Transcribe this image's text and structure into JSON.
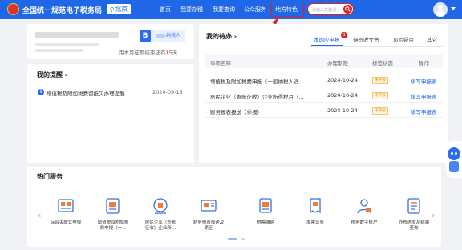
{
  "header": {
    "site_title": "全国统一规范电子税务局",
    "city": "北京",
    "nav": [
      "首页",
      "我要办税",
      "我要查询",
      "公众服务",
      "地方特色"
    ],
    "search_placeholder": "请输入关键词",
    "highlight_color": "#e02020",
    "brand_color": "#1f67e6"
  },
  "user_card": {
    "taxpayer_badge": "B",
    "taxpayer_type": "纳税人",
    "deadline_prefix": "距本月征期结束还有",
    "deadline_days": "15",
    "deadline_suffix": "天"
  },
  "reminders": {
    "title": "我的提醒",
    "title_chevron": "›",
    "items": [
      {
        "text": "增值税及附加税费留抵欠办理提醒",
        "date": "2024-09-13"
      }
    ]
  },
  "todo": {
    "title": "我的待办",
    "title_chevron": "›",
    "tabs": [
      {
        "label": "本期应申报",
        "badge": "3"
      },
      {
        "label": "待签收文书"
      },
      {
        "label": "风险疑点"
      },
      {
        "label": "其它"
      }
    ],
    "columns": [
      "事项名称",
      "办理期限",
      "标签状态",
      "操作"
    ],
    "rows": [
      {
        "name": "增值税及附加税费申报（一般纳税人适...",
        "deadline": "2024-10-24",
        "status": "未申报",
        "action": "填写申报表"
      },
      {
        "name": "居民企业（查账征收）企业所得税月（...",
        "deadline": "2024-10-24",
        "status": "未申报",
        "action": "填写申报表"
      },
      {
        "name": "财务报表报送（季报）",
        "deadline": "2024-10-24",
        "status": "未申报",
        "action": "填写申报表"
      }
    ]
  },
  "hot_services": {
    "title": "热门服务",
    "prev": "‹",
    "next": "›",
    "items": [
      {
        "label": "综合关联式申报",
        "icon": "composite-declaration-icon"
      },
      {
        "label": "增值税及附加税\n费申报（一...",
        "icon": "vat-declaration-icon"
      },
      {
        "label": "居民企业（查账\n征收）企业所...",
        "icon": "enterprise-income-tax-icon"
      },
      {
        "label": "财务报表报送及\n更正",
        "icon": "financial-report-icon"
      },
      {
        "label": "税票缴纳",
        "icon": "tax-payment-icon"
      },
      {
        "label": "发票业务",
        "icon": "invoice-icon"
      },
      {
        "label": "税务数字账户",
        "icon": "digital-account-icon"
      },
      {
        "label": "办税进度及结果\n查询",
        "icon": "progress-query-icon"
      }
    ]
  }
}
